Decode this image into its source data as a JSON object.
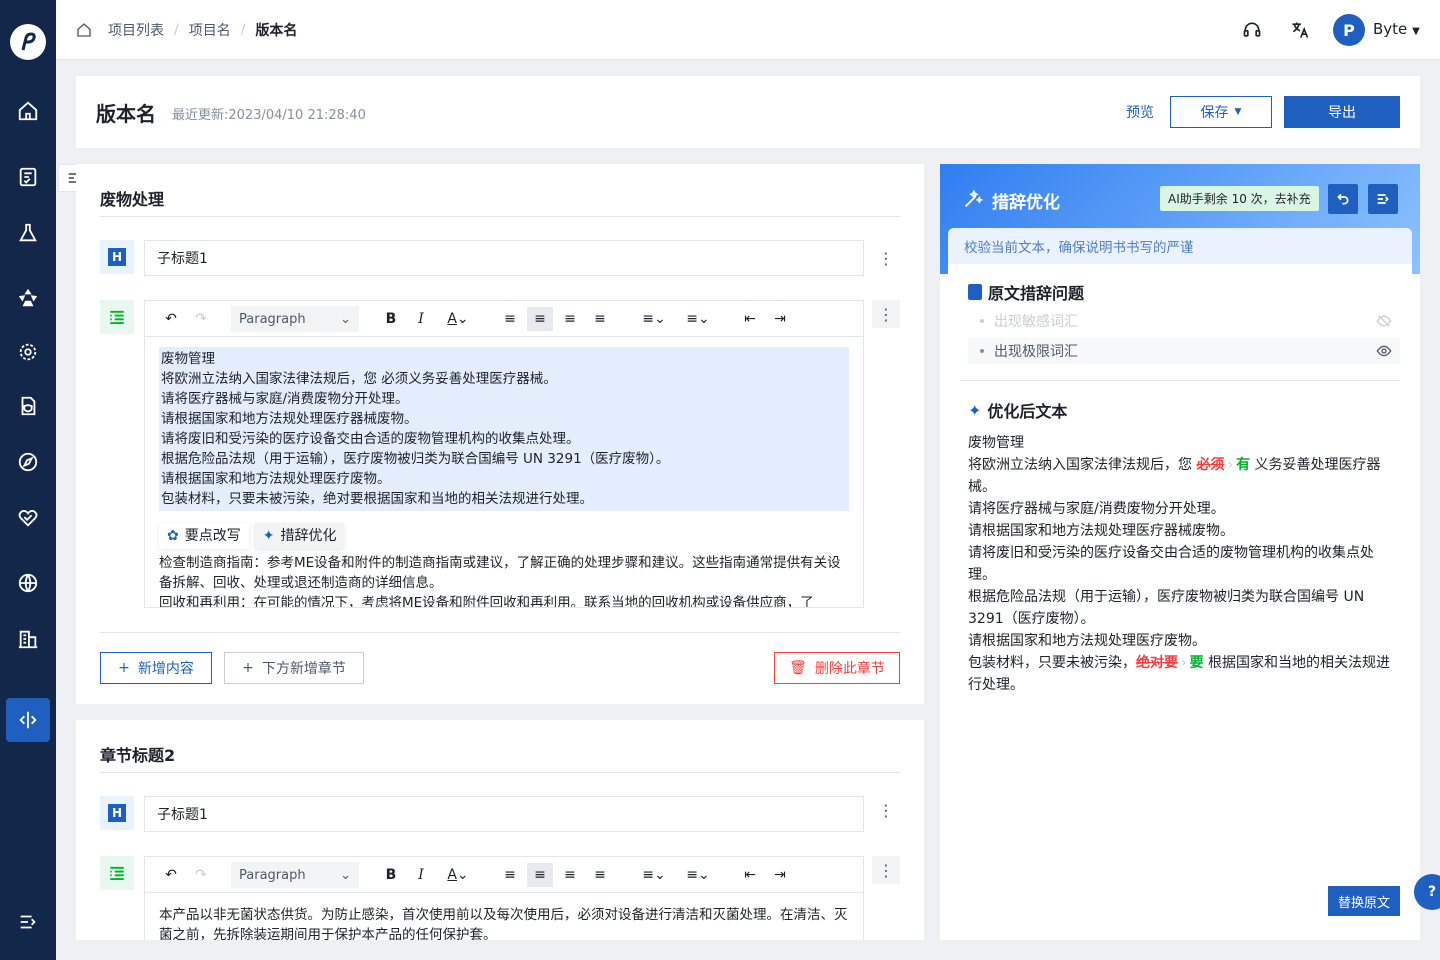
{
  "breadcrumb": [
    "项目列表",
    "项目名",
    "版本名"
  ],
  "user": {
    "initial": "P",
    "name": "Byte"
  },
  "header": {
    "title": "版本名",
    "updated_label": "最近更新:",
    "updated_time": "2023/04/10 21:28:40",
    "preview": "预览",
    "save": "保存",
    "export": "导出"
  },
  "section1": {
    "title": "废物处理",
    "subtitle": "子标题1",
    "toolbar_style": "Paragraph",
    "selected_lines": [
      "废物管理",
      "将欧洲立法纳入国家法律法规后，您 必须义务妥善处理医疗器械。",
      "请将医疗器械与家庭/消费废物分开处理。",
      "请根据国家和地方法规处理医疗器械废物。",
      "请将废旧和受污染的医疗设备交由合适的废物管理机构的收集点处理。",
      "根据危险品法规（用于运输），医疗废物被归类为联合国编号 UN 3291（医疗废物）。",
      "请根据国家和地方法规处理医疗废物。",
      "包装材料，只要未被污染，绝对要根据国家和当地的相关法规进行处理。"
    ],
    "popup": [
      "要点改写",
      "措辞优化"
    ],
    "rest_text": "检查制造商指南：参考ME设备和附件的制造商指南或建议，了解正确的处理步骤和建议。这些指南通常提供有关设备拆解、回收、处理或退还制造商的详细信息。",
    "rest_text2": "回收和再利用：在可能的情况下，考虑将ME设备和附件回收和再利用。联系当地的回收机构或设备供应商，了",
    "add_content": "新增内容",
    "add_chapter": "下方新增章节",
    "delete": "删除此章节"
  },
  "section2": {
    "title": "章节标题2",
    "subtitle": "子标题1",
    "toolbar_style": "Paragraph",
    "text": "本产品以非无菌状态供货。为防止感染，首次使用前以及每次使用后，必须对设备进行清洁和灭菌处理。在清洁、灭菌之前，先拆除装运期间用于保护本产品的任何保护套。"
  },
  "panel": {
    "title": "措辞优化",
    "badge": "AI助手剩余 10 次，去补充",
    "hint": "校验当前文本，确保说明书书写的严谨",
    "issues_title": "原文措辞问题",
    "issues": [
      "出现敏感词汇",
      "出现极限词汇"
    ],
    "optimized_title": "优化后文本",
    "opt": {
      "l1": "废物管理",
      "l2a": "将欧洲立法纳入国家法律法规后，您 ",
      "l2del": "必须",
      "l2add": "有",
      "l2b": " 义务妥善处理医疗器械。",
      "l3": "请将医疗器械与家庭/消费废物分开处理。",
      "l4": "请根据国家和地方法规处理医疗器械废物。",
      "l5": "请将废旧和受污染的医疗设备交由合适的废物管理机构的收集点处理。",
      "l6": "根据危险品法规（用于运输），医疗废物被归类为联合国编号 UN 3291（医疗废物）。",
      "l7": "请根据国家和地方法规处理医疗废物。",
      "l8a": "包装材料，只要未被污染，",
      "l8del": "绝对要",
      "l8add": "要",
      "l8b": " 根据国家和当地的相关法规进行处理。"
    },
    "replace": "替换原文"
  },
  "colors": {
    "primary": "#1f5fbf",
    "sidebar": "#12274a",
    "danger": "#f53f3f",
    "success": "#00b42a"
  },
  "icons": [
    "home-icon",
    "document-check-icon",
    "flask-icon",
    "aperture-icon",
    "settings-gear-icon",
    "file-shield-icon",
    "compass-icon",
    "heart-handshake-icon",
    "globe-icon",
    "building-icon",
    "code-split-icon",
    "collapse-menu-icon"
  ]
}
